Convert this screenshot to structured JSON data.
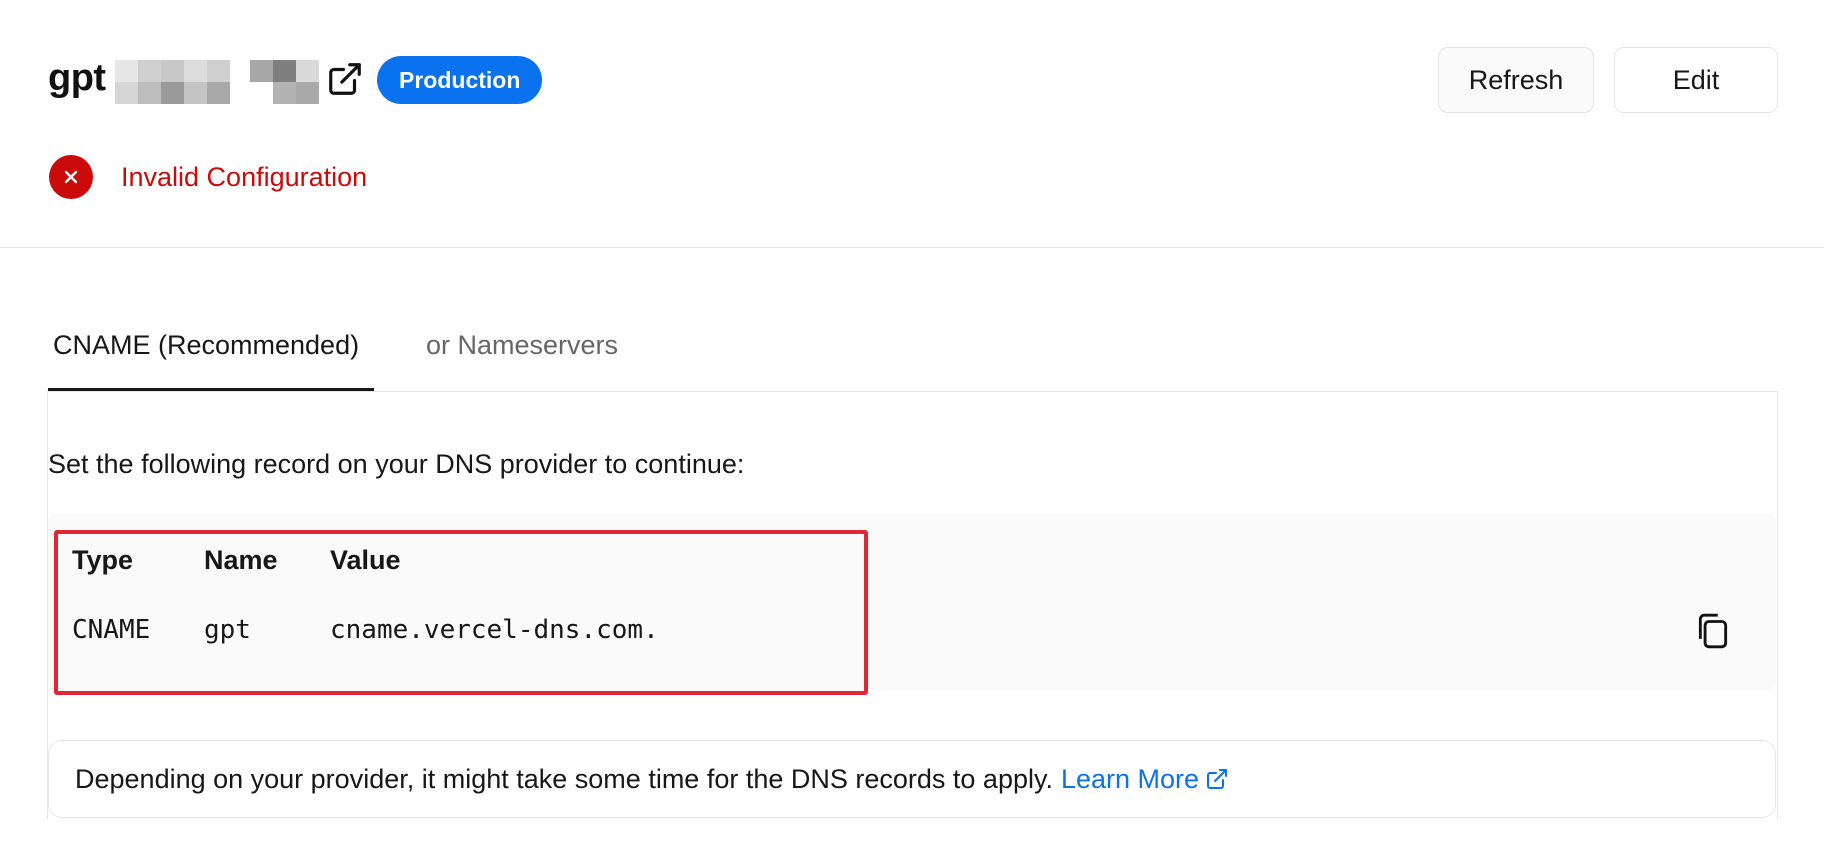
{
  "header": {
    "domain_prefix": "gpt",
    "badge_label": "Production",
    "refresh_label": "Refresh",
    "edit_label": "Edit",
    "status_text": "Invalid Configuration",
    "status_color": "#cb0a0a",
    "badge_color": "#0a72ef"
  },
  "tabs": [
    {
      "label": "CNAME (Recommended)",
      "active": true
    },
    {
      "label": "or Nameservers",
      "active": false
    }
  ],
  "panel": {
    "instruction": "Set the following record on your DNS provider to continue:",
    "columns": [
      "Type",
      "Name",
      "Value"
    ],
    "record": {
      "type": "CNAME",
      "name": "gpt",
      "value": "cname.vercel-dns.com."
    },
    "highlight_color": "#e32636",
    "copy_icon": "copy-icon"
  },
  "note": {
    "text": "Depending on your provider, it might take some time for the DNS records to apply.",
    "link_label": "Learn More",
    "link_color": "#0a72ef"
  }
}
